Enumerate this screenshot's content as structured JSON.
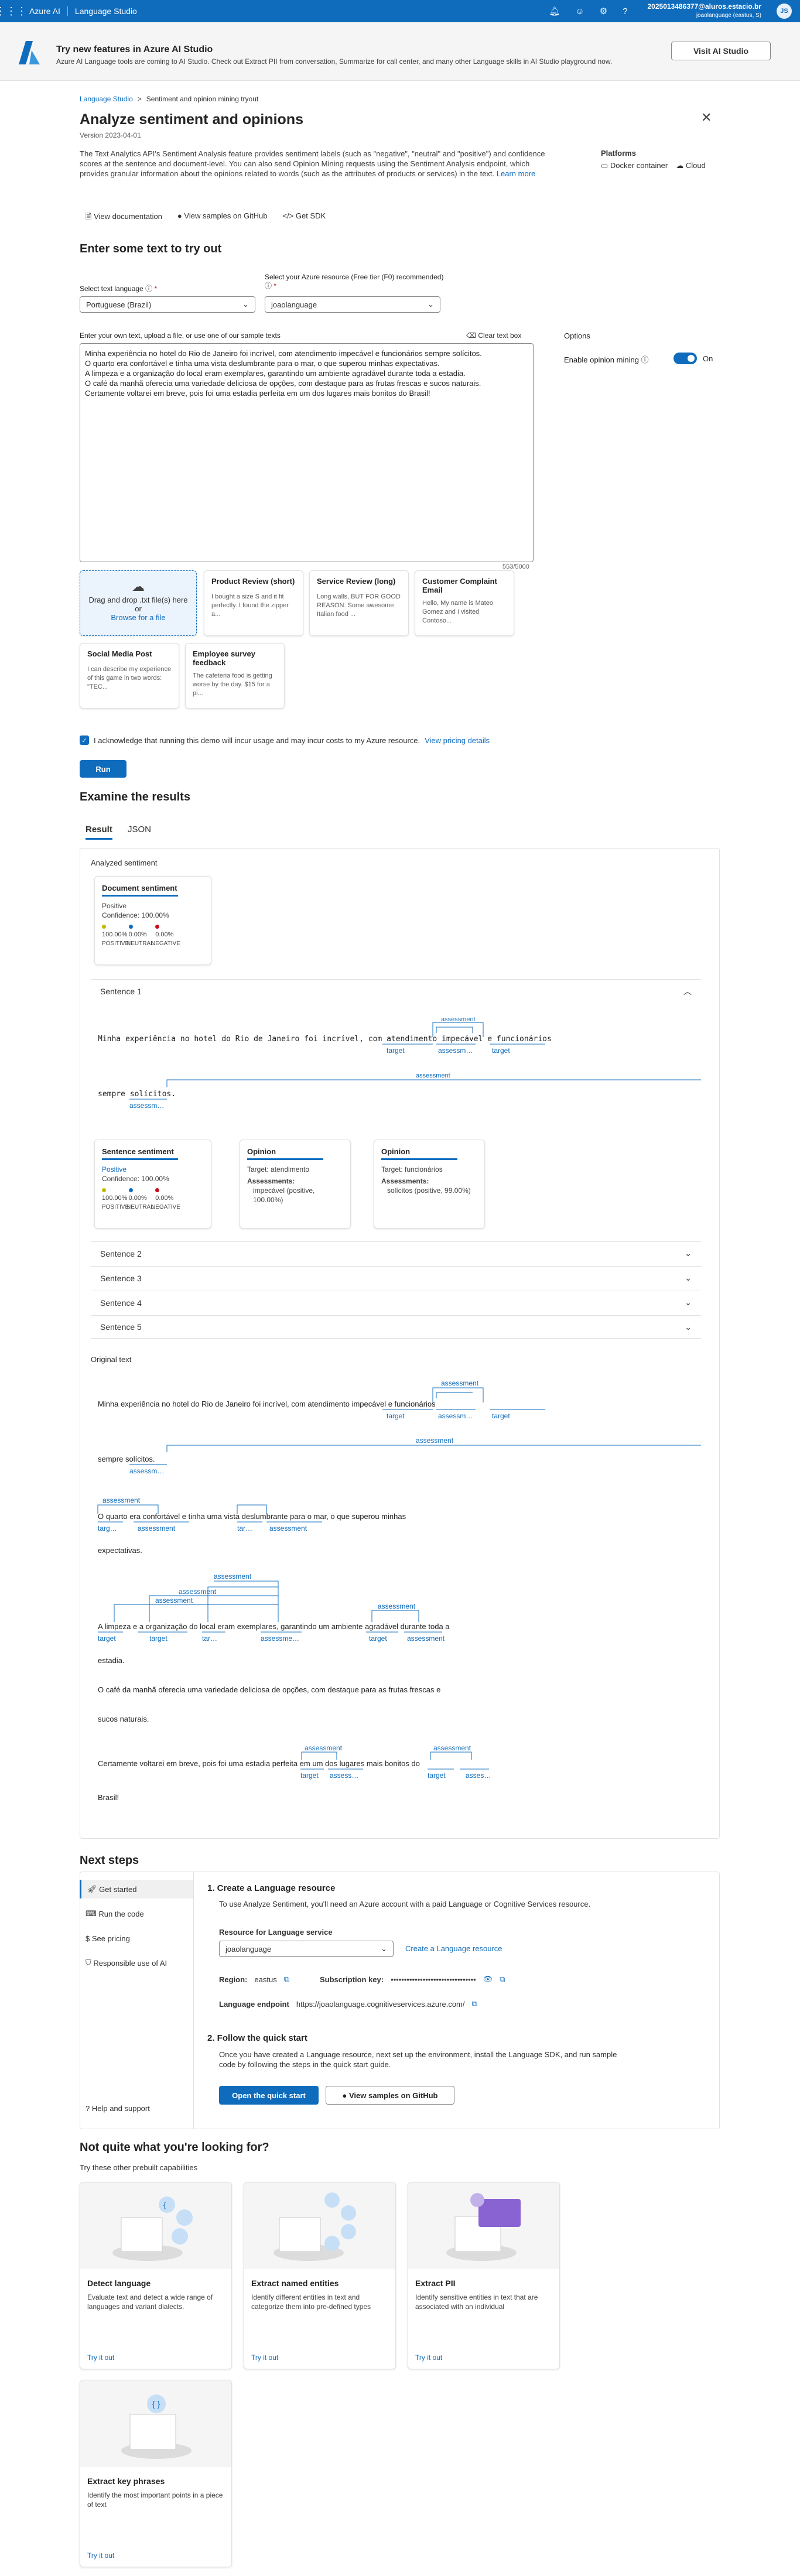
{
  "topbar": {
    "brand": "Azure AI",
    "studio": "Language Studio",
    "user_email": "2025013486377@aluros.estacio.br",
    "user_sub": "joaolanguage (eastus, S)",
    "avatar": "JS"
  },
  "banner": {
    "title": "Try new features in Azure AI Studio",
    "desc": "Azure AI Language tools are coming to AI Studio. Check out Extract PII from conversation, Summarize for call center, and many other Language skills in AI Studio playground now.",
    "button": "Visit AI Studio"
  },
  "breadcrumb": {
    "home": "Language Studio",
    "sep": ">",
    "current": "Sentiment and opinion mining tryout"
  },
  "page": {
    "title": "Analyze sentiment and opinions",
    "version": "Version 2023-04-01",
    "description": "The Text Analytics API's Sentiment Analysis feature provides sentiment labels (such as \"negative\", \"neutral\" and \"positive\") and confidence scores at the sentence and document-level. You can also send Opinion Mining requests using the Sentiment Analysis endpoint, which provides granular information about the opinions related to words (such as the attributes of products or services) in the text.",
    "learn_more": "Learn more",
    "links": [
      "View documentation",
      "View samples on GitHub",
      "Get SDK"
    ],
    "platforms_title": "Platforms",
    "platforms": [
      "Docker container",
      "Cloud"
    ]
  },
  "tryout": {
    "heading": "Enter some text to try out",
    "lang_label": "Select text language",
    "lang_value": "Portuguese (Brazil)",
    "resource_label": "Select your Azure resource (Free tier (F0) recommended)",
    "resource_value": "joaolanguage",
    "text_label": "Enter your own text, upload a file, or use one of our sample texts",
    "clear": "Clear text box",
    "text": "Minha experiência no hotel do Rio de Janeiro foi incrível, com atendimento impecável e funcionários sempre solícitos.\nO quarto era confortável e tinha uma vista deslumbrante para o mar, o que superou minhas expectativas.\nA limpeza e a organização do local eram exemplares, garantindo um ambiente agradável durante toda a estadia.\nO café da manhã oferecia uma variedade deliciosa de opções, com destaque para as frutas frescas e sucos naturais.\nCertamente voltarei em breve, pois foi uma estadia perfeita em um dos lugares mais bonitos do Brasil!",
    "counter": "553/5000",
    "options_title": "Options",
    "opinion_label": "Enable opinion mining",
    "toggle_state": "On",
    "upload": {
      "line1": "Drag and drop .txt file(s) here",
      "line2": "or",
      "line3": "Browse for a file"
    },
    "samples": [
      {
        "title": "Product Review (short)",
        "desc": "I bought a size S and it fit perfectly. I found the zipper a..."
      },
      {
        "title": "Service Review (long)",
        "desc": "Long walls, BUT FOR GOOD REASON. Some awesome Italian food ..."
      },
      {
        "title": "Customer Complaint Email",
        "desc": "Hello, My name is Mateo Gomez and I visited Contoso..."
      },
      {
        "title": "Social Media Post",
        "desc": "I can describe my experience of this game in two words: \"TEC..."
      },
      {
        "title": "Employee survey feedback",
        "desc": "The cafeteria food is getting worse by the day. $15 for a pi..."
      }
    ],
    "ack": "I acknowledge that running this demo will incur usage and may incur costs to my Azure resource.",
    "pricing": "View pricing details",
    "run": "Run"
  },
  "results": {
    "heading": "Examine the results",
    "tabs": [
      "Result",
      "JSON"
    ],
    "analyzed": "Analyzed sentiment",
    "doc": {
      "title": "Document sentiment",
      "label": "Positive",
      "confidence": "Confidence: 100.00%",
      "pos": "100.00%",
      "neu": "0.00%",
      "neg": "0.00%"
    },
    "labels": {
      "pos": "POSITIVE",
      "neu": "NEUTRAL",
      "neg": "NEGATIVE"
    },
    "colors": {
      "pos": "#c5b800",
      "neu": "#0f6cbd",
      "neg": "#c50f1f"
    },
    "sentence1": {
      "title": "Sentence 1",
      "line1": "Minha experiência no hotel do Rio de Janeiro foi incrível, com atendimento impecável e funcionários",
      "line2": "sempre solícitos.",
      "sent": {
        "title": "Sentence sentiment",
        "label": "Positive",
        "confidence": "Confidence: 100.00%",
        "pos": "100.00%",
        "neu": "0.00%",
        "neg": "0.00%"
      },
      "op1": {
        "title": "Opinion",
        "target": "Target: atendimento",
        "assess": "Assessments:",
        "value": "impecável (positive, 100.00%)"
      },
      "op2": {
        "title": "Opinion",
        "target": "Target: funcionários",
        "assess": "Assessments:",
        "value": "solícitos (positive, 99.00%)"
      }
    },
    "collapsed": [
      "Sentence 2",
      "Sentence 3",
      "Sentence 4",
      "Sentence 5"
    ],
    "original_title": "Original text",
    "tag_assessment": "assessment",
    "tag_target": "target",
    "tag_assess_short": "assess…",
    "tag_asses_short": "asses…",
    "tag_assessm": "assessm…",
    "tag_tar": "tar…",
    "tag_targ": "targ…",
    "tag_assessme": "assessme…",
    "orig": {
      "l1": "Minha experiência no hotel do Rio de Janeiro foi incrível, com atendimento impecável e funcionários",
      "l2": "sempre solícitos.",
      "l3": "O quarto era confortável e tinha uma vista deslumbrante para o mar, o que superou minhas",
      "l4": "expectativas.",
      "l5": "A limpeza e a organização do local eram exemplares, garantindo um ambiente agradável durante toda a",
      "l6": "estadia.",
      "l7": "O café da manhã oferecia uma variedade deliciosa de opções, com destaque para as frutas frescas e",
      "l8": "sucos naturais.",
      "l9": "Certamente voltarei em breve, pois foi uma estadia perfeita em um dos lugares mais bonitos do",
      "l10": "Brasil!"
    }
  },
  "next": {
    "heading": "Next steps",
    "nav": [
      "Get started",
      "Run the code",
      "See pricing",
      "Responsible use of AI"
    ],
    "help": "Help and support",
    "step1_title": "1. Create a Language resource",
    "step1_desc": "To use Analyze Sentiment, you'll need an Azure account with a paid Language or Cognitive Services resource.",
    "resource_label": "Resource for Language service",
    "resource_value": "joaolanguage",
    "create_link": "Create a Language resource",
    "region_label": "Region:",
    "region_value": "eastus",
    "key_label": "Subscription key:",
    "key_value": "••••••••••••••••••••••••••••••••",
    "endpoint_label": "Language endpoint",
    "endpoint_value": "https://joaolanguage.cognitiveservices.azure.com/",
    "step2_title": "2. Follow the quick start",
    "step2_desc": "Once you have created a Language resource, next set up the environment, install the Language SDK, and run sample code by following the steps in the quick start guide.",
    "btn_quick": "Open the quick start",
    "btn_github": "View samples on GitHub"
  },
  "other": {
    "heading": "Not quite what you're looking for?",
    "sub": "Try these other prebuilt capabilities",
    "try": "Try it out",
    "cards": [
      {
        "title": "Detect language",
        "desc": "Evaluate text and detect a wide range of languages and variant dialects."
      },
      {
        "title": "Extract named entities",
        "desc": "Identify different entities in text and categorize them into pre-defined types"
      },
      {
        "title": "Extract PII",
        "desc": "Identify sensitive entities in text that are associated with an individual"
      },
      {
        "title": "Extract key phrases",
        "desc": "Identify the most important points in a piece of text"
      }
    ]
  }
}
